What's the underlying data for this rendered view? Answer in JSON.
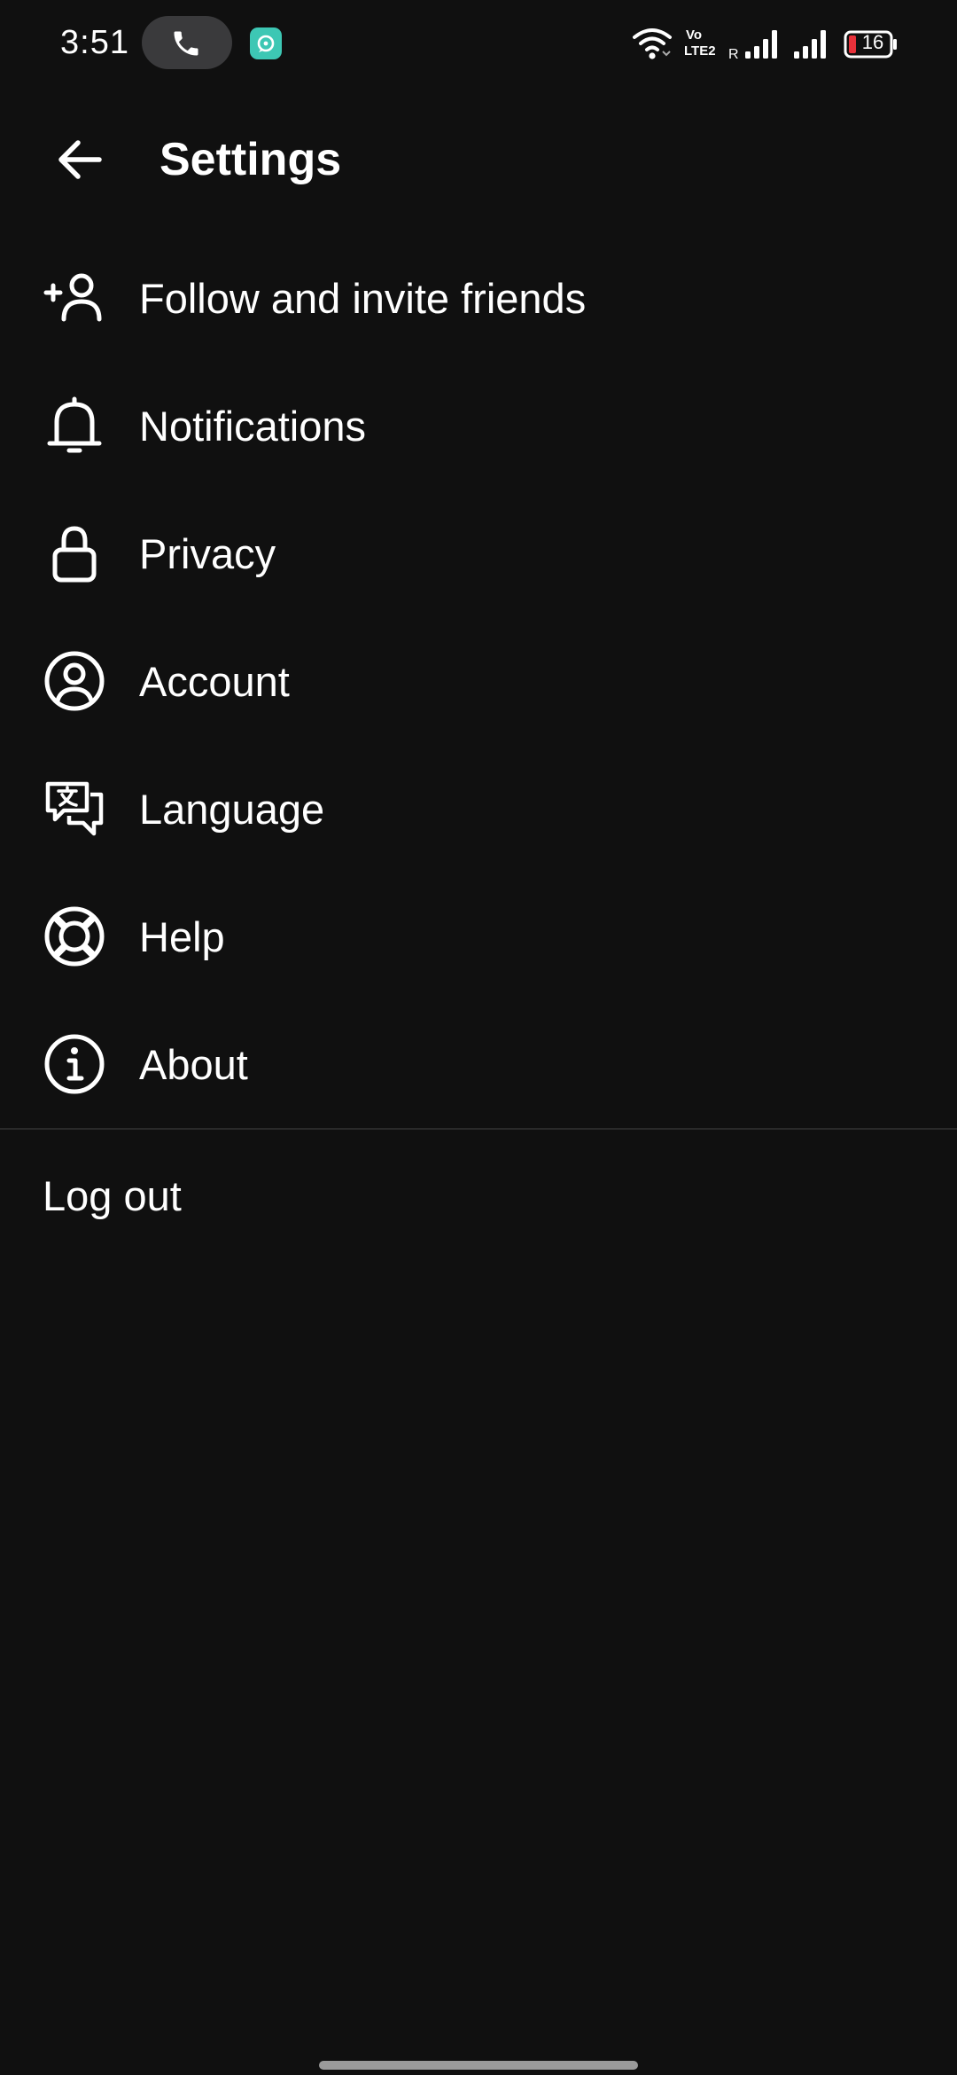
{
  "status_bar": {
    "time": "3:51",
    "battery_level": "16",
    "network_label_line1": "Vo",
    "network_label_line2": "LTE2",
    "roaming_indicator": "R",
    "call_icon": "phone-icon",
    "app_icon": "chat-app-icon"
  },
  "header": {
    "title": "Settings",
    "back_icon": "arrow-left-icon"
  },
  "menu": {
    "items": [
      {
        "label": "Follow and invite friends",
        "icon": "add-person-icon"
      },
      {
        "label": "Notifications",
        "icon": "bell-icon"
      },
      {
        "label": "Privacy",
        "icon": "lock-icon"
      },
      {
        "label": "Account",
        "icon": "account-circle-icon"
      },
      {
        "label": "Language",
        "icon": "translate-chat-icon"
      },
      {
        "label": "Help",
        "icon": "lifebuoy-icon"
      },
      {
        "label": "About",
        "icon": "info-icon"
      }
    ],
    "logout_label": "Log out"
  },
  "colors": {
    "background": "#101010",
    "text": "#ffffff",
    "call_pill": "#3a3a3c",
    "app_chip": "#3dc7b4",
    "battery_low": "#e8313a",
    "divider": "#2a2a2a"
  }
}
